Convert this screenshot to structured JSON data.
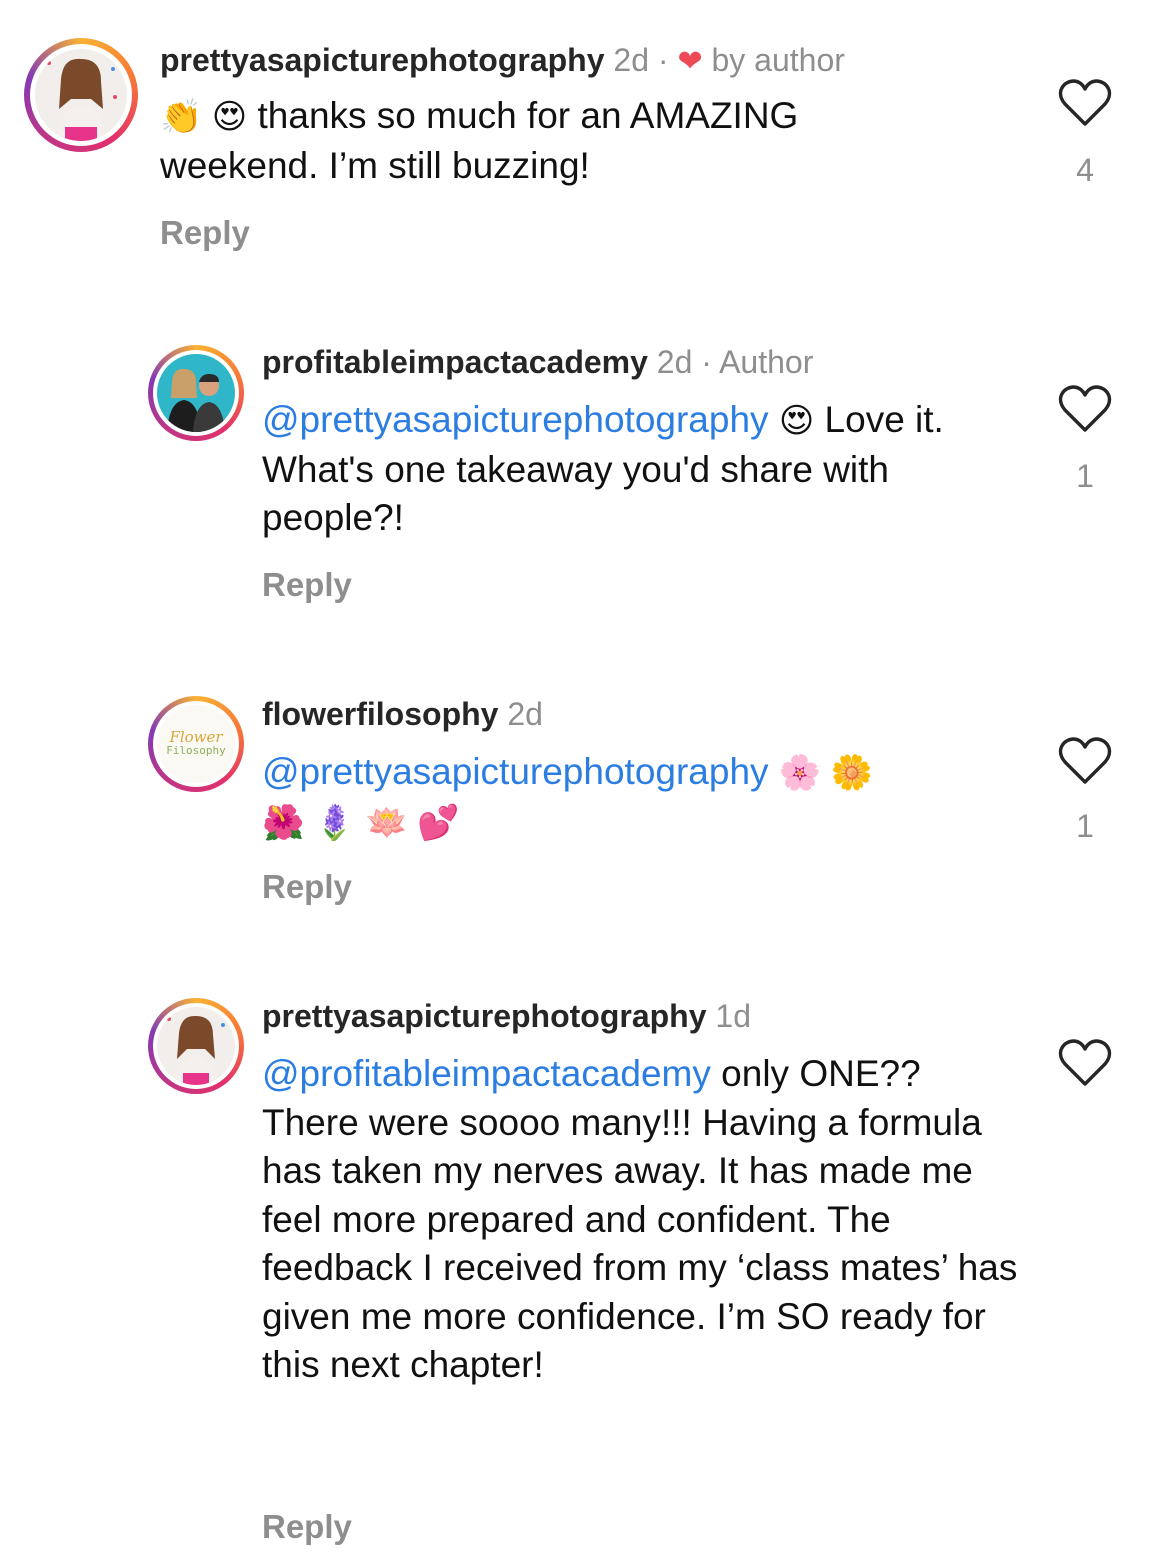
{
  "comments": [
    {
      "username": "prettyasapicturephotography",
      "time": "2d",
      "separator": "·",
      "liked_by_author_label": "by author",
      "emoji_prefix": "👏 😍",
      "text": "thanks so much for an AMAZING weekend. I’m still buzzing!",
      "reply_label": "Reply",
      "like_count": "4"
    },
    {
      "username": "profitableimpactacademy",
      "time": "2d",
      "separator": "·",
      "author_label": "Author",
      "mention": "@prettyasapicturephotography",
      "emoji_after_mention": "😍",
      "text": "Love it. What's one takeaway you'd share with people?!",
      "reply_label": "Reply",
      "like_count": "1"
    },
    {
      "username": "flowerfilosophy",
      "time": "2d",
      "mention": "@prettyasapicturephotography",
      "emoji_line1": "🌸 🌼",
      "emoji_line2": "🌺 🪻 🪷 💕",
      "reply_label": "Reply",
      "like_count": "1"
    },
    {
      "username": "prettyasapicturephotography",
      "time": "1d",
      "mention": "@profitableimpactacademy",
      "text_after_mention": "only",
      "text": "ONE?? There were soooo many!!! Having a formula has taken my nerves away. It has made me feel more prepared and confident. The feedback I received from my ‘class mates’ has given me more confidence. I’m SO ready for this next chapter!",
      "reply_label": "Reply"
    }
  ],
  "avatar3_logo_text": [
    "Flower",
    "Filosophy"
  ],
  "colors": {
    "mention": "#2b7de1",
    "meta": "#8e8e8e",
    "heart": "#ed4956"
  }
}
